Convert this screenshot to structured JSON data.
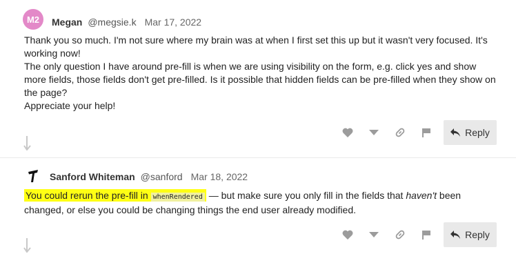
{
  "posts": [
    {
      "avatar_text": "M2",
      "avatar_color": "#e389c8",
      "author": "Megan",
      "handle": "@megsie.k",
      "date": "Mar 17, 2022",
      "body": [
        "Thank you so much. I'm not sure where my brain was at when I first set this up but it wasn't very focused. It's working now!",
        "The only question I have around pre-fill is when we are using visibility on the form, e.g. click yes and show more fields, those fields don't get pre-filled. Is it possible that hidden fields can be pre-filled when they show on the page?",
        "Appreciate your help!"
      ],
      "reply_label": "Reply"
    },
    {
      "avatar_icon": "tee-logo-icon",
      "author": "Sanford Whiteman",
      "handle": "@sanford",
      "date": "Mar 18, 2022",
      "body_highlight": "You could rerun the pre-fill in",
      "body_code": "whenRendered",
      "body_mid": " — but make sure you only fill in the fields that ",
      "body_em": "haven't",
      "body_rest": " been changed, or else you could be changing things the end user already modified.",
      "reply_label": "Reply"
    }
  ],
  "colors": {
    "highlight": "#ffff14",
    "action_icon": "#9c9c9c",
    "reply_bg": "#e9e9e9"
  }
}
